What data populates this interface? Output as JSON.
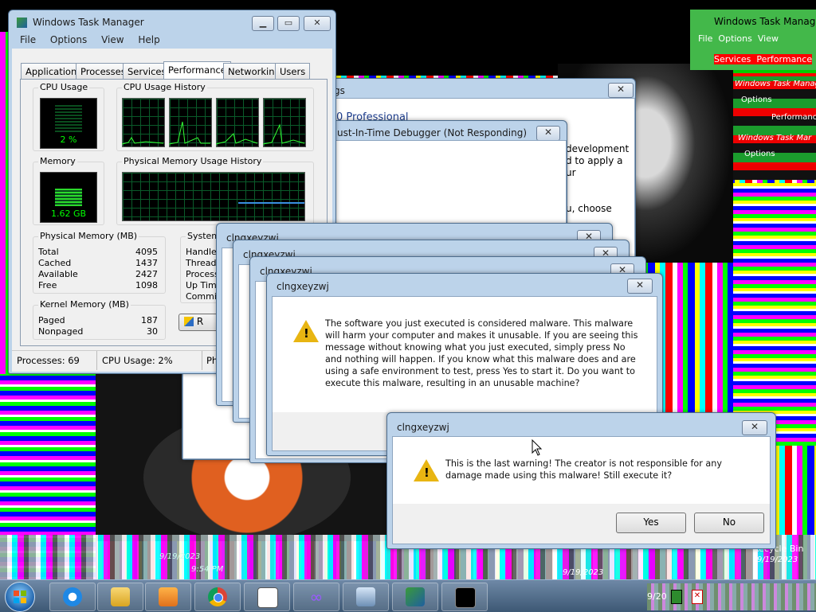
{
  "taskmgr": {
    "title": "Windows Task Manager",
    "menu": [
      "File",
      "Options",
      "View",
      "Help"
    ],
    "tabs": [
      "Applications",
      "Processes",
      "Services",
      "Performance",
      "Networking",
      "Users"
    ],
    "cpu_usage_label": "CPU Usage",
    "cpu_usage_value": "2 %",
    "cpu_history_label": "CPU Usage History",
    "memory_label": "Memory",
    "memory_value": "1.62 GB",
    "phys_history_label": "Physical Memory Usage History",
    "physical_memory": {
      "title": "Physical Memory (MB)",
      "rows": [
        {
          "k": "Total",
          "v": "4095"
        },
        {
          "k": "Cached",
          "v": "1437"
        },
        {
          "k": "Available",
          "v": "2427"
        },
        {
          "k": "Free",
          "v": "1098"
        }
      ]
    },
    "system": {
      "title": "System",
      "rows": [
        "Handles",
        "Threads",
        "Processe",
        "Up Time",
        "Commit"
      ]
    },
    "kernel_memory": {
      "title": "Kernel Memory (MB)",
      "rows": [
        {
          "k": "Paged",
          "v": "187"
        },
        {
          "k": "Nonpaged",
          "v": "30"
        }
      ]
    },
    "resource_btn": "R",
    "status": {
      "processes": "Processes: 69",
      "cpu": "CPU Usage: 2%",
      "phys": "Ph"
    }
  },
  "ghost_taskmgr": {
    "title": "Windows Task Manager",
    "menu": [
      "File",
      "Options",
      "View"
    ],
    "tabs": [
      "Services",
      "Performance"
    ],
    "title2": "Windows Task Manag",
    "menu2": "Options",
    "tab2": "Performanc",
    "title3": "Windows Task Mar",
    "menu3": "Options"
  },
  "bg_window": {
    "title_fragment": "gs",
    "heading_fragment": "0 Professional",
    "text_lines": [
      "development",
      "d to apply a",
      "ur",
      "u, choose"
    ]
  },
  "debugger": {
    "title": "ust-In-Time Debugger (Not Responding)"
  },
  "stacked_titles": [
    "clngxeyzwj",
    "clngxeyzwj",
    "clngxeyzwj"
  ],
  "dialog1": {
    "title": "clngxeyzwj",
    "message": "The software you just executed is considered malware. This malware will harm your computer and makes it unusable. If you are seeing this message without knowing what you just executed, simply press No and nothing will happen. If you know what this malware does and are using a safe environment to test, press Yes to start it. Do you want to execute this malware, resulting in an unusable machine?"
  },
  "dialog2": {
    "title": "clngxeyzwj",
    "message": "This is the last warning! The creator is not responsible for any damage made using this malware! Still execute it?",
    "yes": "Yes",
    "no": "No"
  },
  "desktop": {
    "recycle_bin": "Recycle Bin",
    "dates": [
      "9/19/2023",
      "9/19/2023",
      "9/19/2023",
      "9/19/202"
    ],
    "time": "9:54 PM"
  },
  "taskbar": {
    "items": [
      "start-orb",
      "internet-explorer",
      "file-explorer",
      "media-player",
      "chrome",
      "notepad",
      "visual-studio",
      "control-panel",
      "task-manager",
      "cmd"
    ],
    "clock_fragment": "9/20"
  }
}
